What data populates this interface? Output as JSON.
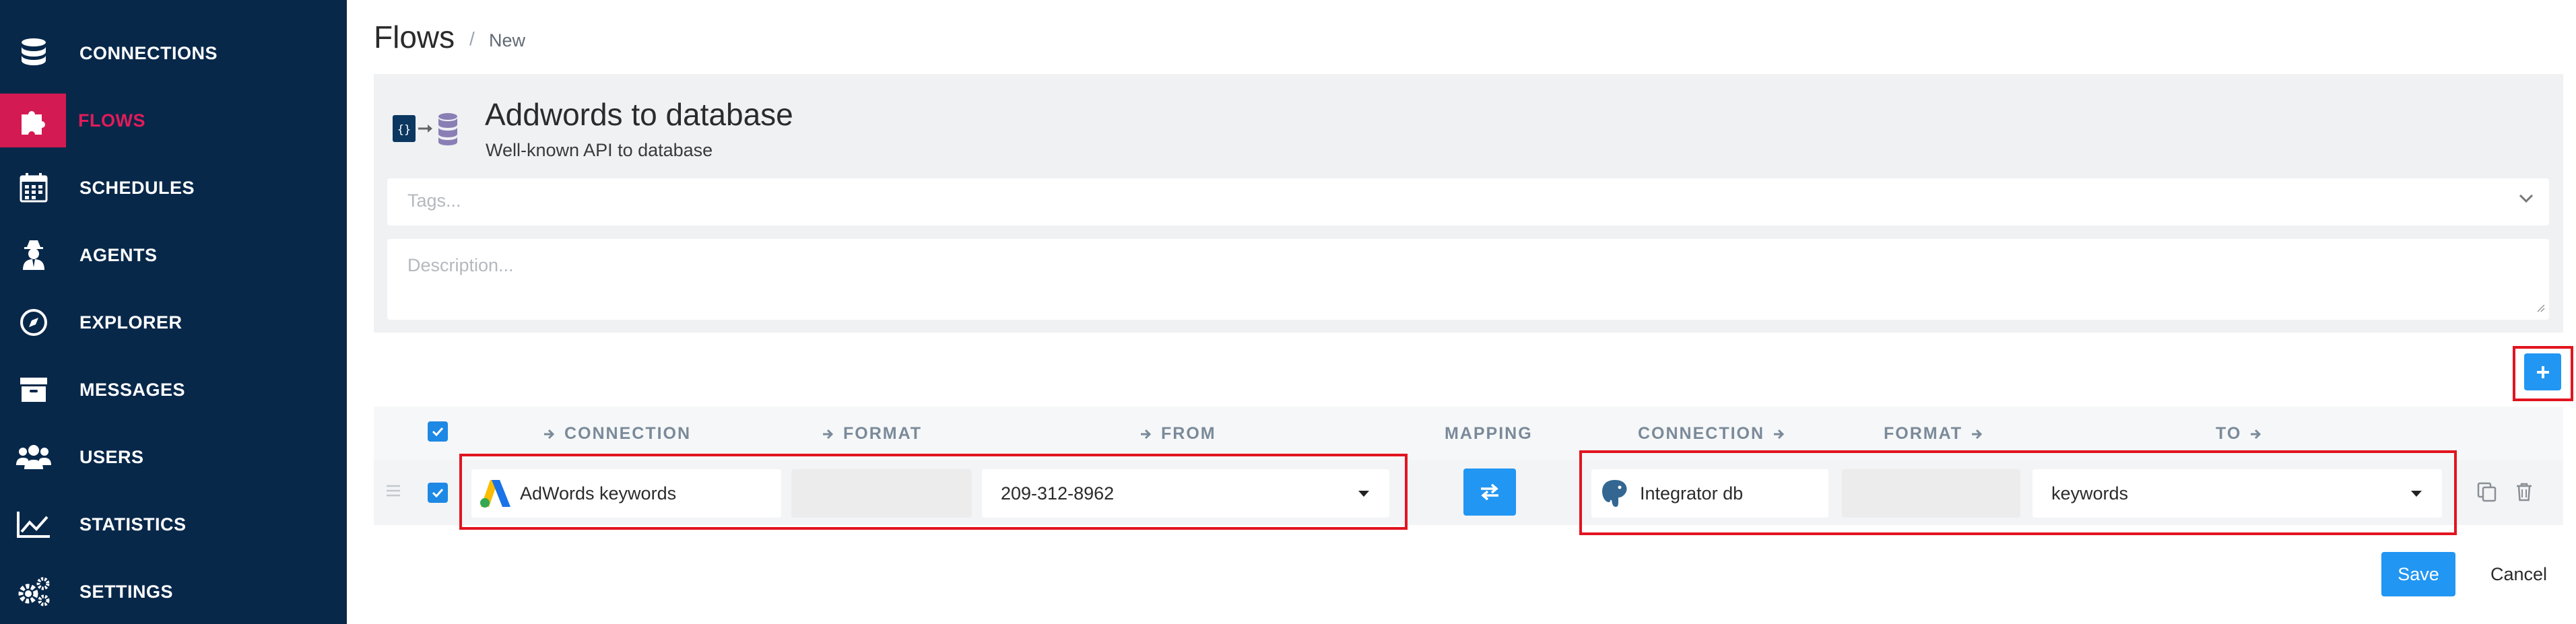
{
  "sidebar": {
    "items": [
      {
        "label": "CONNECTIONS",
        "icon": "database-icon"
      },
      {
        "label": "FLOWS",
        "icon": "puzzle-icon",
        "active": true
      },
      {
        "label": "SCHEDULES",
        "icon": "calendar-icon"
      },
      {
        "label": "AGENTS",
        "icon": "agent-icon"
      },
      {
        "label": "EXPLORER",
        "icon": "compass-icon"
      },
      {
        "label": "MESSAGES",
        "icon": "inbox-icon"
      },
      {
        "label": "USERS",
        "icon": "users-icon"
      },
      {
        "label": "STATISTICS",
        "icon": "chart-line-icon"
      },
      {
        "label": "SETTINGS",
        "icon": "gears-icon"
      }
    ]
  },
  "header": {
    "title": "Flows",
    "separator": "/",
    "crumb": "New"
  },
  "flow": {
    "title": "Addwords to database",
    "subtitle": "Well-known API to database",
    "tags_placeholder": "Tags...",
    "description_placeholder": "Description..."
  },
  "table": {
    "headers": {
      "src_connection": "CONNECTION",
      "src_format": "FORMAT",
      "from": "FROM",
      "mapping": "MAPPING",
      "dst_connection": "CONNECTION",
      "dst_format": "FORMAT",
      "to": "TO"
    },
    "row": {
      "src_connection": "AdWords keywords",
      "src_format": "",
      "from": "209-312-8962",
      "dst_connection": "Integrator db",
      "dst_format": "",
      "to": "keywords"
    }
  },
  "actions": {
    "save": "Save",
    "cancel": "Cancel"
  },
  "colors": {
    "sidebar": "#08284a",
    "accent": "#d31a53",
    "primary": "#2196f3",
    "highlight": "#e1141f"
  }
}
